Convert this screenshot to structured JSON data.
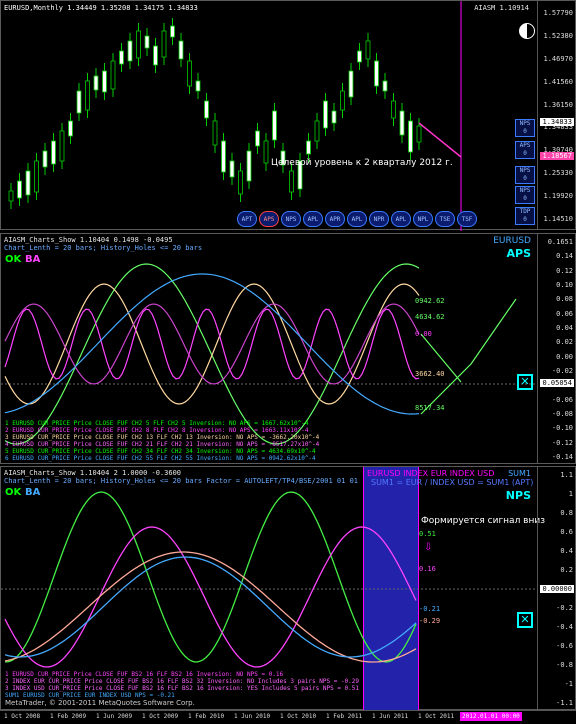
{
  "main": {
    "title": "EURUSD,Monthly  1.34449 1.35208 1.34175 1.34833",
    "top_right": "AIASM 1.10914",
    "annotation": "Целевой уровень к 2 кварталу 2012 г.",
    "price_ticks": [
      "1.57790",
      "1.52380",
      "1.46970",
      "1.41560",
      "1.36150",
      "1.34833",
      "1.30740",
      "1.25330",
      "1.19920",
      "1.14510"
    ],
    "buttons": [
      "APT",
      "APS",
      "NPS",
      "APL",
      "APR",
      "APL",
      "NPR",
      "APL",
      "NPL",
      "TSE",
      "TSF"
    ],
    "right_buttons": [
      "NPS\n0",
      "APS\n0",
      "NPS\n0",
      "NPS\n0",
      "TDP\n0"
    ]
  },
  "aps": {
    "header1": "AIASM_Charts_Show 1.10404 0.1498 -0.0495",
    "header2": "Chart_Lenth = 20 bars; History_Holes <= 20 bars",
    "label_ok": "OK",
    "label_ba": "BA",
    "symbol": "EURUSD",
    "name": "APS",
    "value_label": "0.05054",
    "ticks": [
      "0.1651",
      "0.14",
      "0.12",
      "0.10",
      "0.08",
      "0.06",
      "0.04",
      "0.02",
      "0.00",
      "-0.02",
      "-0.04",
      "-0.06",
      "-0.08",
      "-0.10",
      "-0.12",
      "-0.14"
    ],
    "curve_labels": [
      "0942.62",
      "4634.62",
      "0.00",
      "3662.40",
      "8517.34"
    ],
    "legend": [
      {
        "text": "1  EURUSD   CUR_PRICE  Price CLOSE   FUF CH2 5    FLF CH2 5    Inversion: NO    APS = 1667.62x10^-4",
        "color": "#00ff00"
      },
      {
        "text": "2  EURUSD   CUR_PRICE  Price CLOSE   FUF CH2 8    FLF CH2 8    Inversion: NO    APS = 1663.11x10^-4",
        "color": "#ff44ff"
      },
      {
        "text": "3  EURUSD   CUR_PRICE  Price CLOSE   FUF CH2 13   FLF CH2 13   Inversion: NO    APS = -3662.20x10^-4",
        "color": "#ffd8a0"
      },
      {
        "text": "4  EURUSD   CUR_PRICE  Price CLOSE   FUF CH2 21   FLF CH2 21   Inversion: NO    APS = -8517.27x10^-4",
        "color": "#ff66ff"
      },
      {
        "text": "5  EURUSD   CUR_PRICE  Price CLOSE   FUF CH2 34   FLF CH2 34   Inversion: NO    APS = 4634.69x10^-4",
        "color": "#00ff00"
      },
      {
        "text": "6  EURUSD   CUR_PRICE  Price CLOSE   FUF CH2 55   FLF CH2 55   Inversion: NO    APS = 0942.62x10^-4",
        "color": "#44aaff"
      }
    ]
  },
  "nps": {
    "header1": "AIASM_Charts_Show 1.10404 2 1.0000 -0.3600",
    "header2": "Chart_Lenth = 20 bars; History_Holes <= 20 bars   Factor = AUTOLEFT/TP4/BSE/2001 01 01",
    "label_ok": "OK",
    "label_ba": "BA",
    "symbol": "SUM1",
    "name": "NPS",
    "info1": "EURUSD  INDEX EUR  INDEX USD",
    "info2": "SUM1 = EUR / INDEX USD = SUM1 (APT)",
    "signal": "Формируется сигнал вниз",
    "value_label": "0.00000",
    "ticks": [
      "1.1",
      "1",
      "0.8",
      "0.6",
      "0.4",
      "0.2",
      "0.00000",
      "-0.2",
      "-0.4",
      "-0.6",
      "-0.8",
      "-1",
      "-1.1"
    ],
    "curve_labels": [
      "0.51",
      "0.16",
      "-0.21",
      "-0.29"
    ],
    "copyright": "MetaTrader, © 2001-2011 MetaQuotes Software Corp.",
    "legend": [
      {
        "text": "1  EURUSD   CUR_PRICE  Price CLOSE   FUF BS2 16   FLF BS2 16   Inversion: NO                      NPS = 0.16",
        "color": "#ff44ff"
      },
      {
        "text": "2  INDEX EUR  CUR_PRICE  Price CLOSE   FUF BS2 16   FLF BS2 32   Inversion: NO   Includes 3 pairs  NPS = -0.29",
        "color": "#ff66ff"
      },
      {
        "text": "3  INDEX USD  CUR_PRICE  Price CLOSE   FUF BS2 16   FLF BS2 16   Inversion: YES  Includes 5 pairs  NPS = 0.51",
        "color": "#ff66ff"
      },
      {
        "text": "   SUM1   EURUSD   CUR_PRICE   EUR   INDEX USD                                      NPS = -0.21",
        "color": "#44aaff"
      }
    ],
    "time_labels": [
      "1 Oct 2008",
      "1 Feb 2009",
      "1 Jun 2009",
      "1 Oct 2009",
      "1 Feb 2010",
      "1 Jun 2010",
      "1 Oct 2010",
      "1 Feb 2011",
      "1 Jun 2011",
      "1 Oct 2011"
    ],
    "cursor_time": "2012.01.01 00:00"
  },
  "colors": {
    "magenta": "#ff00ff",
    "green": "#00ff00",
    "blue_panel": "#2222aa",
    "cyan": "#00ffff"
  }
}
